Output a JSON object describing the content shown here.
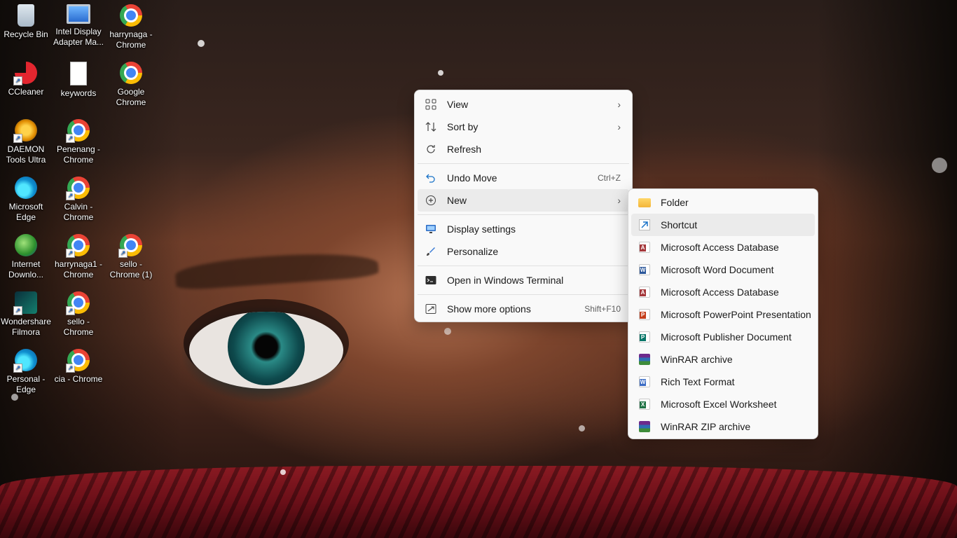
{
  "desktop": {
    "icons": [
      {
        "label": "Recycle Bin",
        "icon": "recycle-bin-icon"
      },
      {
        "label": "Intel Display Adapter Ma...",
        "icon": "monitor-icon"
      },
      {
        "label": "harrynaga - Chrome",
        "icon": "chrome-icon"
      },
      {
        "label": "CCleaner",
        "icon": "ccleaner-icon"
      },
      {
        "label": "keywords",
        "icon": "text-file-icon"
      },
      {
        "label": "Google Chrome",
        "icon": "chrome-icon"
      },
      {
        "label": "DAEMON Tools Ultra",
        "icon": "daemon-tools-icon"
      },
      {
        "label": "Penenang - Chrome",
        "icon": "chrome-icon"
      },
      {
        "label": "Microsoft Edge",
        "icon": "edge-icon"
      },
      {
        "label": "Calvin - Chrome",
        "icon": "chrome-icon"
      },
      {
        "label": "Internet Downlo...",
        "icon": "idm-icon"
      },
      {
        "label": "harrynaga1 - Chrome",
        "icon": "chrome-icon"
      },
      {
        "label": "sello - Chrome (1)",
        "icon": "chrome-icon"
      },
      {
        "label": "Wondershare Filmora",
        "icon": "filmora-icon"
      },
      {
        "label": "sello - Chrome",
        "icon": "chrome-icon"
      },
      {
        "label": "Personal - Edge",
        "icon": "edge-icon"
      },
      {
        "label": "cia - Chrome",
        "icon": "chrome-icon"
      }
    ]
  },
  "context_menu": {
    "view": "View",
    "sort_by": "Sort by",
    "refresh": "Refresh",
    "undo_move": "Undo Move",
    "undo_shortcut": "Ctrl+Z",
    "new": "New",
    "display_settings": "Display settings",
    "personalize": "Personalize",
    "open_terminal": "Open in Windows Terminal",
    "show_more": "Show more options",
    "show_more_shortcut": "Shift+F10"
  },
  "new_submenu": {
    "items": [
      "Folder",
      "Shortcut",
      "Microsoft Access Database",
      "Microsoft Word Document",
      "Microsoft Access Database",
      "Microsoft PowerPoint Presentation",
      "Microsoft Publisher Document",
      "WinRAR archive",
      "Rich Text Format",
      "Microsoft Excel Worksheet",
      "WinRAR ZIP archive"
    ]
  }
}
